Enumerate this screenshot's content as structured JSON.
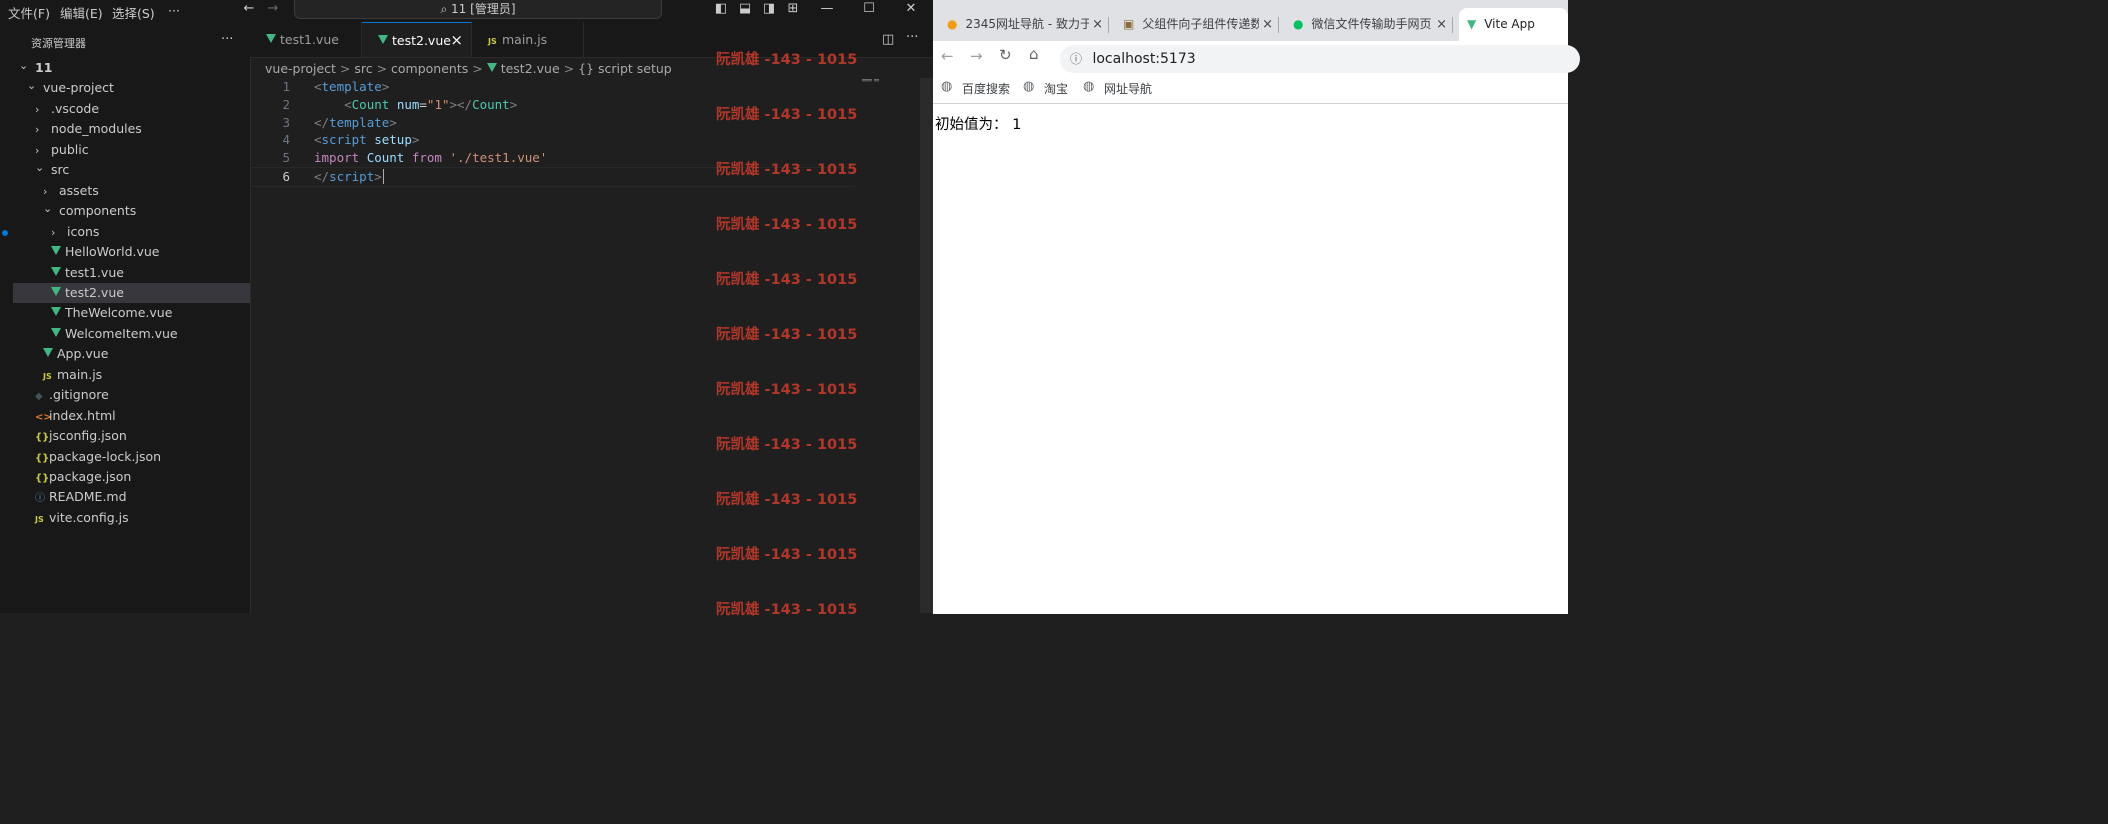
{
  "vscode": {
    "menu": [
      "文件(F)",
      "编辑(E)",
      "选择(S)",
      "···"
    ],
    "command_center": "11 [管理员]",
    "explorer": {
      "title": "资源管理器",
      "more": "···",
      "items": [
        {
          "label": "11",
          "depth": 0,
          "kind": "folder-open"
        },
        {
          "label": "vue-project",
          "depth": 1,
          "kind": "folder-open"
        },
        {
          "label": ".vscode",
          "depth": 2,
          "kind": "folder"
        },
        {
          "label": "node_modules",
          "depth": 2,
          "kind": "folder"
        },
        {
          "label": "public",
          "depth": 2,
          "kind": "folder"
        },
        {
          "label": "src",
          "depth": 2,
          "kind": "folder-open"
        },
        {
          "label": "assets",
          "depth": 3,
          "kind": "folder"
        },
        {
          "label": "components",
          "depth": 3,
          "kind": "folder-open"
        },
        {
          "label": "icons",
          "depth": 4,
          "kind": "folder"
        },
        {
          "label": "HelloWorld.vue",
          "depth": 4,
          "kind": "vue"
        },
        {
          "label": "test1.vue",
          "depth": 4,
          "kind": "vue"
        },
        {
          "label": "test2.vue",
          "depth": 4,
          "kind": "vue",
          "selected": true
        },
        {
          "label": "TheWelcome.vue",
          "depth": 4,
          "kind": "vue"
        },
        {
          "label": "WelcomeItem.vue",
          "depth": 4,
          "kind": "vue"
        },
        {
          "label": "App.vue",
          "depth": 3,
          "kind": "vue"
        },
        {
          "label": "main.js",
          "depth": 3,
          "kind": "js"
        },
        {
          "label": ".gitignore",
          "depth": 2,
          "kind": "git"
        },
        {
          "label": "index.html",
          "depth": 2,
          "kind": "html"
        },
        {
          "label": "jsconfig.json",
          "depth": 2,
          "kind": "json"
        },
        {
          "label": "package-lock.json",
          "depth": 2,
          "kind": "json"
        },
        {
          "label": "package.json",
          "depth": 2,
          "kind": "json"
        },
        {
          "label": "README.md",
          "depth": 2,
          "kind": "info"
        },
        {
          "label": "vite.config.js",
          "depth": 2,
          "kind": "js"
        }
      ]
    },
    "tabs": [
      {
        "label": "test1.vue",
        "kind": "vue"
      },
      {
        "label": "test2.vue",
        "kind": "vue",
        "active": true
      },
      {
        "label": "main.js",
        "kind": "js"
      }
    ],
    "tab_close": "×",
    "breadcrumb": [
      "vue-project",
      "src",
      "components",
      "test2.vue",
      "{} script setup"
    ],
    "code_line_numbers": [
      "1",
      "2",
      "3",
      "4",
      "5",
      "6"
    ],
    "watermark": "阮凯雄 -143 - 1015",
    "watermark_count": 11
  },
  "browser": {
    "tabs": [
      {
        "label": "2345网址导航 - 致力于",
        "icon": "2345"
      },
      {
        "label": "父组件向子组件传递数",
        "icon": "img"
      },
      {
        "label": "微信文件传输助手网页",
        "icon": "wechat"
      },
      {
        "label": "Vite App",
        "icon": "vite",
        "active": true
      }
    ],
    "tab_close": "×",
    "url": "localhost:5173",
    "bookmarks": [
      "百度搜索",
      "淘宝",
      "网址导航"
    ],
    "page_text": "初始值为： 1"
  }
}
